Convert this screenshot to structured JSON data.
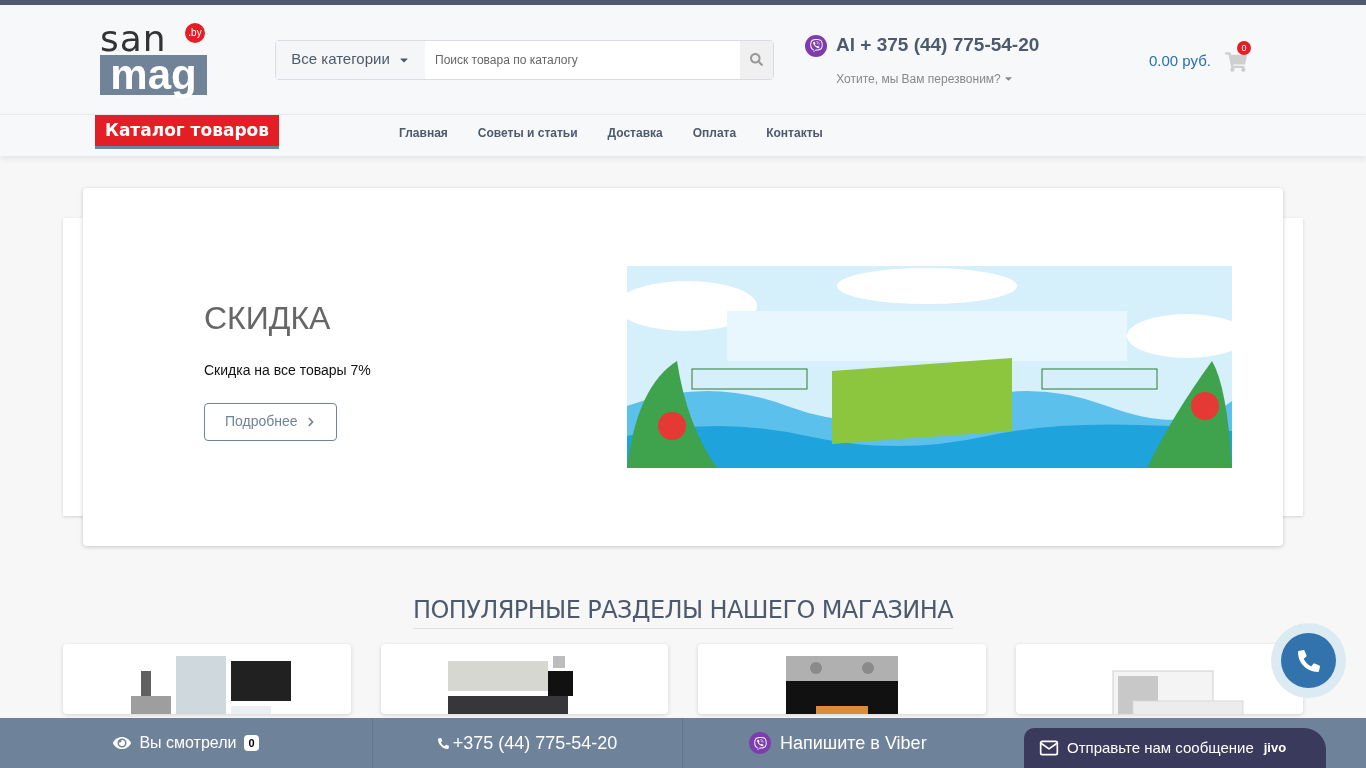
{
  "header": {
    "logo": {
      "top": "san",
      "bottom": "mag",
      "badge": ".by"
    },
    "category_select": "Все категории",
    "search": {
      "placeholder": "Поиск товара по каталогу"
    },
    "phone": "Al + 375 (44) 775-54-20",
    "callback": "Хотите, мы Вам перезвоним?",
    "cart": {
      "total": "0.00 руб.",
      "count": "0"
    }
  },
  "catalog_button": "Каталог товаров",
  "nav": [
    "Главная",
    "Советы и статьи",
    "Доставка",
    "Оплата",
    "Контакты"
  ],
  "promo": {
    "title": "СКИДКА",
    "text": "Скидка на все товары 7%",
    "button": "Подробнее"
  },
  "section_title": "ПОПУЛЯРНЫЕ РАЗДЕЛЫ НАШЕГО МАГАЗИНА",
  "bottom_bar": {
    "viewed": {
      "label": "Вы смотрели",
      "count": "0"
    },
    "phone": "+375 (44) 775-54-20",
    "viber": "Напишите в Viber"
  },
  "chat": {
    "label": "Отправьте нам сообщение",
    "brand": "jivo"
  }
}
